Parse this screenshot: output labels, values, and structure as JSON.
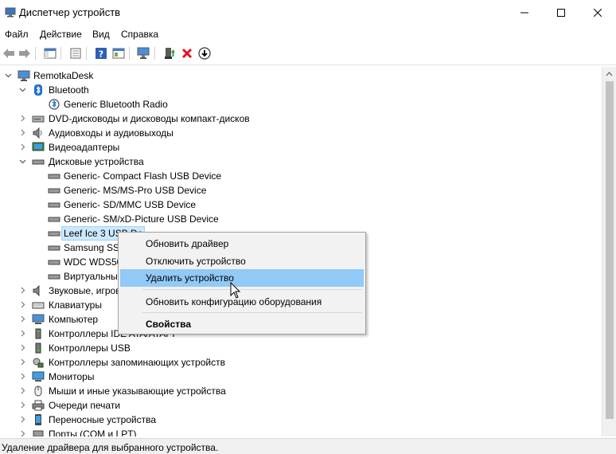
{
  "window": {
    "title": "Диспетчер устройств",
    "minimize_icon": "minimize-icon",
    "maximize_icon": "maximize-icon",
    "close_icon": "close-icon"
  },
  "menu": [
    "Файл",
    "Действие",
    "Вид",
    "Справка"
  ],
  "toolbar": [
    "back-arrow-icon",
    "forward-arrow-icon",
    "show-hide-tree-icon",
    "properties-icon",
    "help-icon",
    "update-driver-icon",
    "scan-hardware-icon",
    "enable-device-icon",
    "uninstall-device-icon",
    "download-icon"
  ],
  "tree": {
    "root": "RemotkaDesk",
    "bluetooth": {
      "label": "Bluetooth",
      "children": [
        "Generic Bluetooth Radio"
      ]
    },
    "dvd": "DVD-дисководы и дисководы компакт-дисков",
    "audio_io": "Аудиовходы и аудиовыходы",
    "video": "Видеоадаптеры",
    "disks": {
      "label": "Дисковые устройства",
      "children": [
        "Generic- Compact Flash USB Device",
        "Generic- MS/MS-Pro USB Device",
        "Generic- SD/MMC USB Device",
        "Generic- SM/xD-Picture USB Device",
        "Leef Ice 3 USB De",
        "Samsung SSD",
        "WDC WDS50",
        "Виртуальный"
      ]
    },
    "rest": [
      "Звуковые, игров",
      "Клавиатуры",
      "Компьютер",
      "Контроллеры IDE ATA/ATAPI",
      "Контроллеры USB",
      "Контроллеры запоминающих устройств",
      "Мониторы",
      "Мыши и иные указывающие устройства",
      "Очереди печати",
      "Переносные устройства",
      "Порты (COM и LPT)"
    ]
  },
  "context_menu": {
    "update_driver": "Обновить драйвер",
    "disable_device": "Отключить устройство",
    "uninstall_device": "Удалить устройство",
    "scan_hardware": "Обновить конфигурацию оборудования",
    "properties": "Свойства"
  },
  "status": "Удаление драйвера для выбранного устройства.",
  "colors": {
    "highlight": "#91c9f7",
    "selection": "#cce8ff",
    "red_x": "#e81123"
  }
}
